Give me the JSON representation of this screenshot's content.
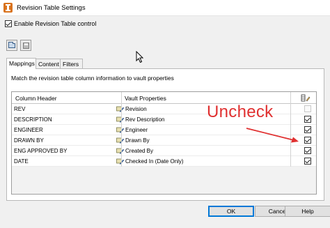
{
  "window": {
    "title": "Revision Table Settings"
  },
  "enable_control": {
    "label": "Enable Revision Table control",
    "checked": true
  },
  "toolbar": {
    "open_icon": "folder-open-icon",
    "save_icon": "save-icon"
  },
  "tabs": [
    {
      "label": "Mappings",
      "active": true
    },
    {
      "label": "Content",
      "active": false
    },
    {
      "label": "Filters",
      "active": false
    }
  ],
  "mappings": {
    "description": "Match the revision table column information to vault properties",
    "columns": {
      "column_header": "Column Header",
      "vault_properties": "Vault Properties",
      "edit_icon": "edit-column-icon"
    },
    "rows": [
      {
        "column_header": "REV",
        "vault_property": "Revision",
        "checked": false,
        "enabled": false
      },
      {
        "column_header": "DESCRIPTION",
        "vault_property": "Rev Description",
        "checked": true,
        "enabled": true
      },
      {
        "column_header": "ENGINEER",
        "vault_property": "Engineer",
        "checked": true,
        "enabled": true
      },
      {
        "column_header": "DRAWN BY",
        "vault_property": "Drawn By",
        "checked": true,
        "enabled": true
      },
      {
        "column_header": "ENG APPROVED BY",
        "vault_property": "Created By",
        "checked": true,
        "enabled": true
      },
      {
        "column_header": "DATE",
        "vault_property": "Checked In (Date Only)",
        "checked": true,
        "enabled": true
      }
    ]
  },
  "annotation": {
    "text": "Uncheck",
    "color": "#e03030"
  },
  "buttons": {
    "ok": "OK",
    "cancel": "Cancel",
    "help": "Help"
  }
}
